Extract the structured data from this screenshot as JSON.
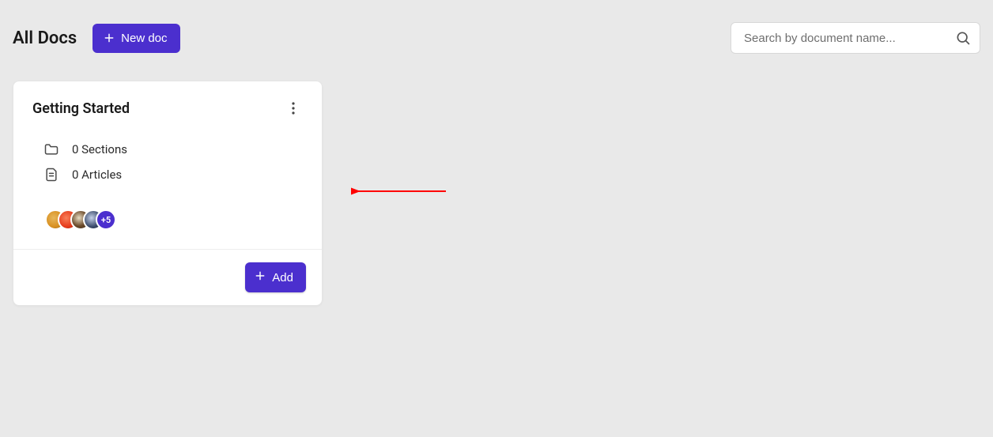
{
  "header": {
    "title": "All Docs",
    "new_doc_label": "New doc"
  },
  "search": {
    "placeholder": "Search by document name...",
    "value": ""
  },
  "docs": [
    {
      "title": "Getting Started",
      "sections_label": "0 Sections",
      "articles_label": "0 Articles",
      "avatars_overflow": "+5",
      "add_label": "Add"
    }
  ],
  "colors": {
    "primary": "#4b2fce",
    "page_bg": "#e9e9e9"
  }
}
